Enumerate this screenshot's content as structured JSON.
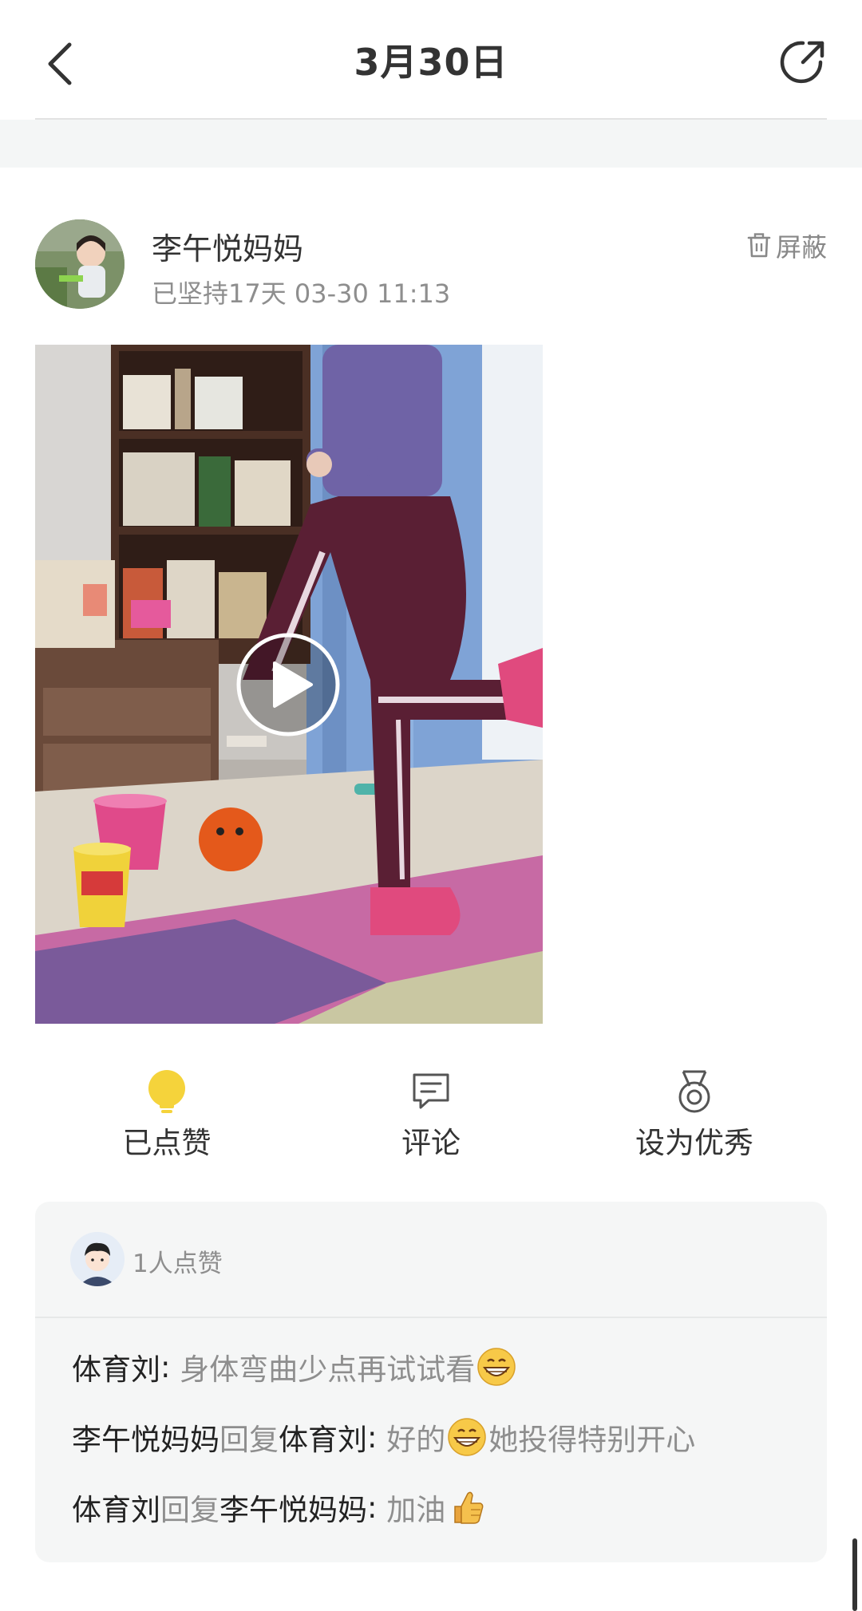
{
  "header": {
    "title": "3月30日",
    "back_icon": "chevron-left-icon",
    "share_icon": "share-icon"
  },
  "post": {
    "author": "李午悦妈妈",
    "meta": "已坚持17天 03-30 11:13",
    "block_label": "屏蔽",
    "block_icon": "trash-icon",
    "media": {
      "type": "video",
      "play_icon": "play-icon"
    }
  },
  "actions": [
    {
      "label": "已点赞",
      "icon": "lightbulb-icon",
      "active": true,
      "color": "#f5d33b"
    },
    {
      "label": "评论",
      "icon": "comment-icon"
    },
    {
      "label": "设为优秀",
      "icon": "medal-icon"
    }
  ],
  "likes": {
    "text": "1人点赞"
  },
  "comments": [
    {
      "author": "体育刘",
      "separator": ": ",
      "text": "身体弯曲少点再试试看",
      "emoji_after": "grin-emoji"
    },
    {
      "author": "李午悦妈妈",
      "reply_word": "回复",
      "reply_to": "体育刘",
      "separator": ": ",
      "text_before": "好的",
      "emoji_mid": "grin-emoji",
      "text_after": "她投得特别开心"
    },
    {
      "author": "体育刘",
      "reply_word": "回复",
      "reply_to": "李午悦妈妈",
      "separator": ": ",
      "text": "加油",
      "emoji_after": "thumbs-up-emoji"
    }
  ]
}
